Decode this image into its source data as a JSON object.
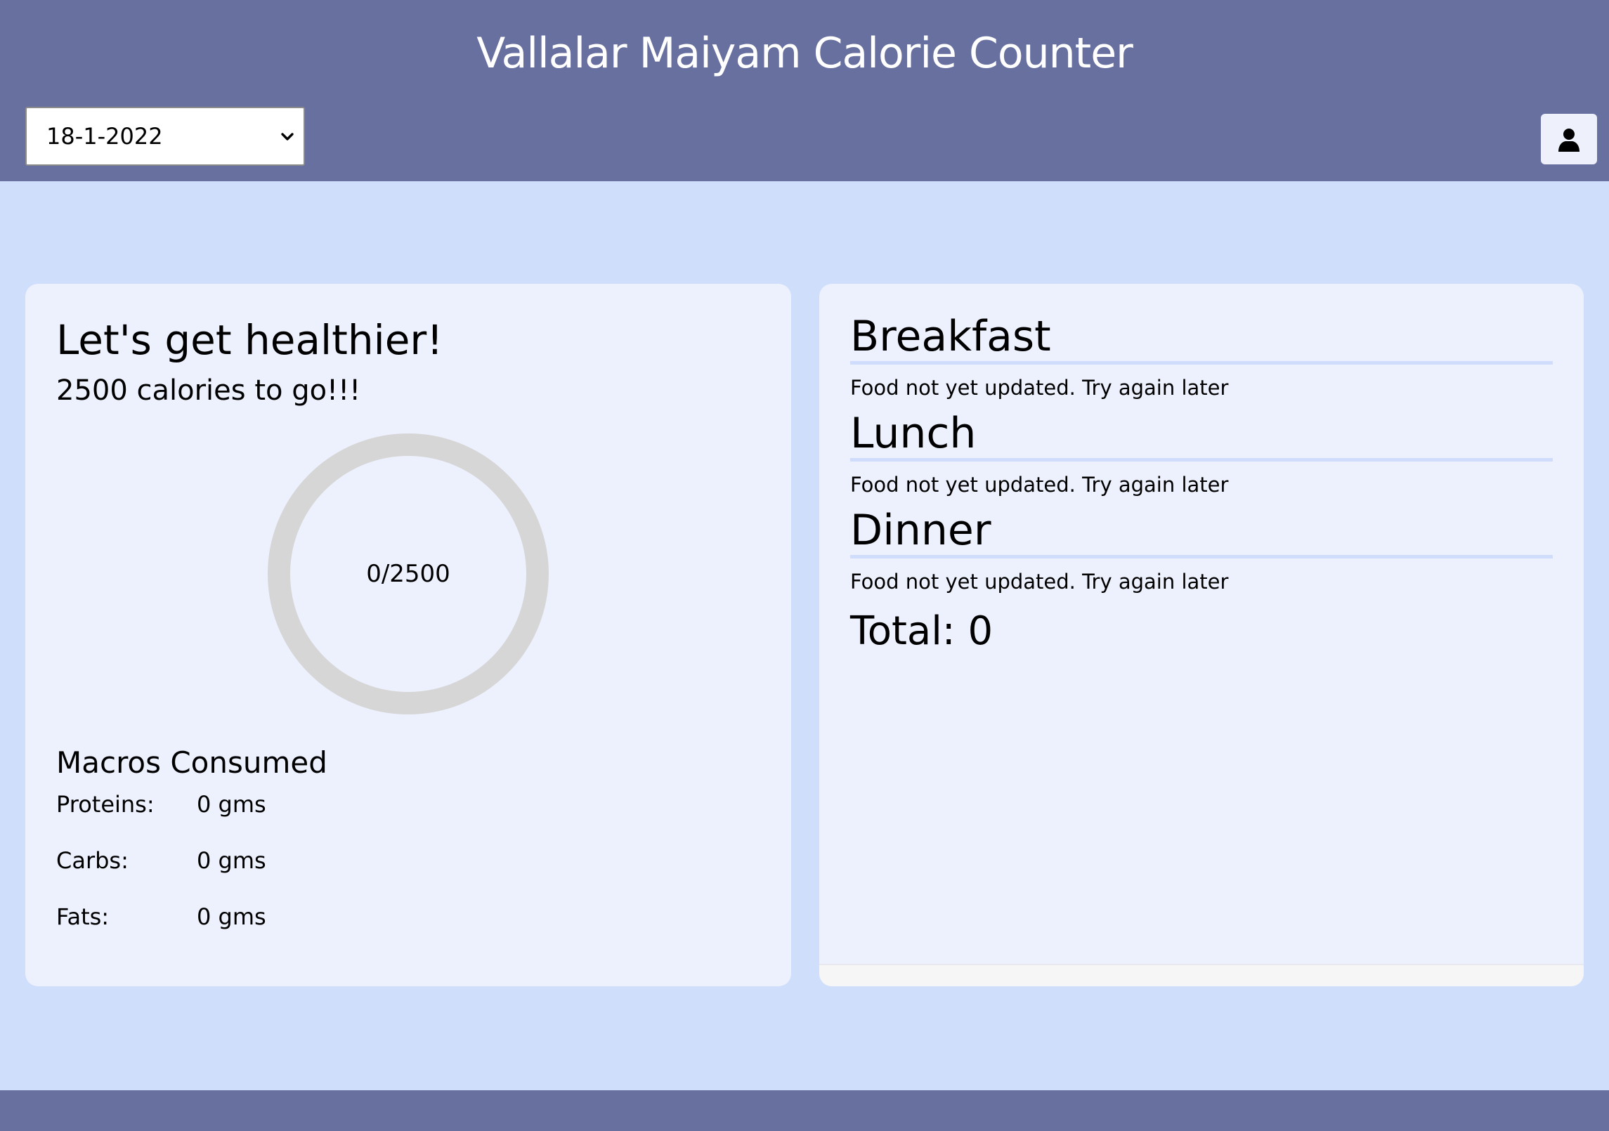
{
  "header": {
    "title": "Vallalar Maiyam Calorie Counter",
    "date_select": {
      "selected": "18-1-2022",
      "icon": "chevron-down-icon"
    },
    "user_button": {
      "icon": "user-icon"
    }
  },
  "summary": {
    "greeting": "Let's get healthier!",
    "remaining": "2500 calories to go!!!",
    "progress": {
      "label": "0/2500",
      "consumed": 0,
      "goal": 2500
    },
    "macros": {
      "title": "Macros Consumed",
      "items": [
        {
          "label": "Proteins:",
          "value": "0 gms"
        },
        {
          "label": "Carbs:",
          "value": "0 gms"
        },
        {
          "label": "Fats:",
          "value": "0 gms"
        }
      ]
    }
  },
  "meals": {
    "items": [
      {
        "name": "Breakfast",
        "status": "Food not yet updated. Try again later"
      },
      {
        "name": "Lunch",
        "status": "Food not yet updated. Try again later"
      },
      {
        "name": "Dinner",
        "status": "Food not yet updated. Try again later"
      }
    ],
    "total": "Total: 0"
  },
  "colors": {
    "header_bg": "#6870a0",
    "page_bg": "#cfdefb",
    "card_bg": "#edf1fd",
    "ring_track": "#d6d6d6",
    "meal_divider": "#cfdcfb"
  }
}
